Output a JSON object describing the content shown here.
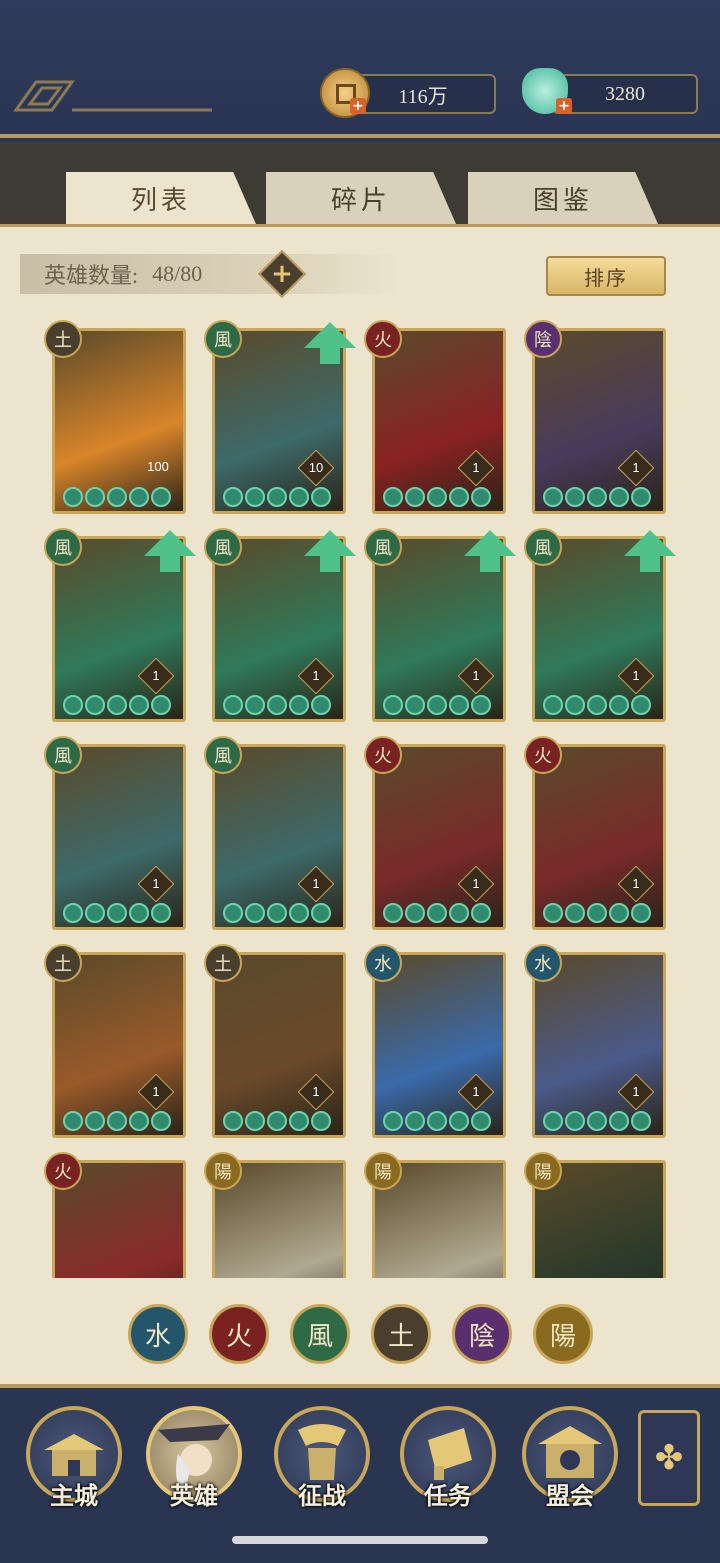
{
  "resources": {
    "coins": {
      "value": "116万",
      "icon": "coin-icon"
    },
    "jade": {
      "value": "3280",
      "icon": "jade-pouch-icon"
    }
  },
  "tabs": [
    {
      "label": "列表",
      "active": true
    },
    {
      "label": "碎片",
      "active": false
    },
    {
      "label": "图鉴",
      "active": false
    }
  ],
  "hero_count": {
    "label": "英雄数量:",
    "value": "48/80"
  },
  "sort_button": "排序",
  "elements": {
    "earth": {
      "glyph": "土",
      "color": "#4a3f2e"
    },
    "wind": {
      "glyph": "風",
      "color": "#2f6a46"
    },
    "fire": {
      "glyph": "火",
      "color": "#7a2222"
    },
    "yin": {
      "glyph": "陰",
      "color": "#5a2f6e"
    },
    "water": {
      "glyph": "水",
      "color": "#23566a"
    },
    "yang": {
      "glyph": "陽",
      "color": "#8a6a1e"
    }
  },
  "heroes": [
    {
      "element": "earth",
      "level": "100",
      "upgrade": false,
      "bg": "#d9852a"
    },
    {
      "element": "wind",
      "level": "10",
      "upgrade": true,
      "bg": "#3d6a6a"
    },
    {
      "element": "fire",
      "level": "1",
      "upgrade": false,
      "bg": "#8a2222"
    },
    {
      "element": "yin",
      "level": "1",
      "upgrade": false,
      "bg": "#4a3a5c"
    },
    {
      "element": "wind",
      "level": "1",
      "upgrade": true,
      "bg": "#2f7a5a"
    },
    {
      "element": "wind",
      "level": "1",
      "upgrade": true,
      "bg": "#2f7a5a"
    },
    {
      "element": "wind",
      "level": "1",
      "upgrade": true,
      "bg": "#2f7a5a"
    },
    {
      "element": "wind",
      "level": "1",
      "upgrade": true,
      "bg": "#2f7a5a"
    },
    {
      "element": "wind",
      "level": "1",
      "upgrade": false,
      "bg": "#3d6a6a"
    },
    {
      "element": "wind",
      "level": "1",
      "upgrade": false,
      "bg": "#3d6a6a"
    },
    {
      "element": "fire",
      "level": "1",
      "upgrade": false,
      "bg": "#7a2a2a"
    },
    {
      "element": "fire",
      "level": "1",
      "upgrade": false,
      "bg": "#7a2a2a"
    },
    {
      "element": "earth",
      "level": "1",
      "upgrade": false,
      "bg": "#9a5a2a"
    },
    {
      "element": "earth",
      "level": "1",
      "upgrade": false,
      "bg": "#6a4a2a"
    },
    {
      "element": "water",
      "level": "1",
      "upgrade": false,
      "bg": "#3a6aaa"
    },
    {
      "element": "water",
      "level": "1",
      "upgrade": false,
      "bg": "#4a5a8a"
    },
    {
      "element": "fire",
      "level": "",
      "upgrade": false,
      "bg": "#8a2a2a"
    },
    {
      "element": "yang",
      "level": "",
      "upgrade": false,
      "bg": "#b0a890"
    },
    {
      "element": "yang",
      "level": "",
      "upgrade": false,
      "bg": "#b0a890"
    },
    {
      "element": "yang",
      "level": "",
      "upgrade": false,
      "bg": "#2a3a2a"
    }
  ],
  "filters": [
    "water",
    "fire",
    "wind",
    "earth",
    "yin",
    "yang"
  ],
  "nav": [
    {
      "label": "主城",
      "icon": "palace-icon"
    },
    {
      "label": "英雄",
      "icon": "hero-portrait-icon"
    },
    {
      "label": "征战",
      "icon": "war-scroll-icon"
    },
    {
      "label": "任务",
      "icon": "quest-scroll-icon"
    },
    {
      "label": "盟会",
      "icon": "guild-hall-icon"
    }
  ],
  "menu_icon": "four-petal-menu-icon"
}
